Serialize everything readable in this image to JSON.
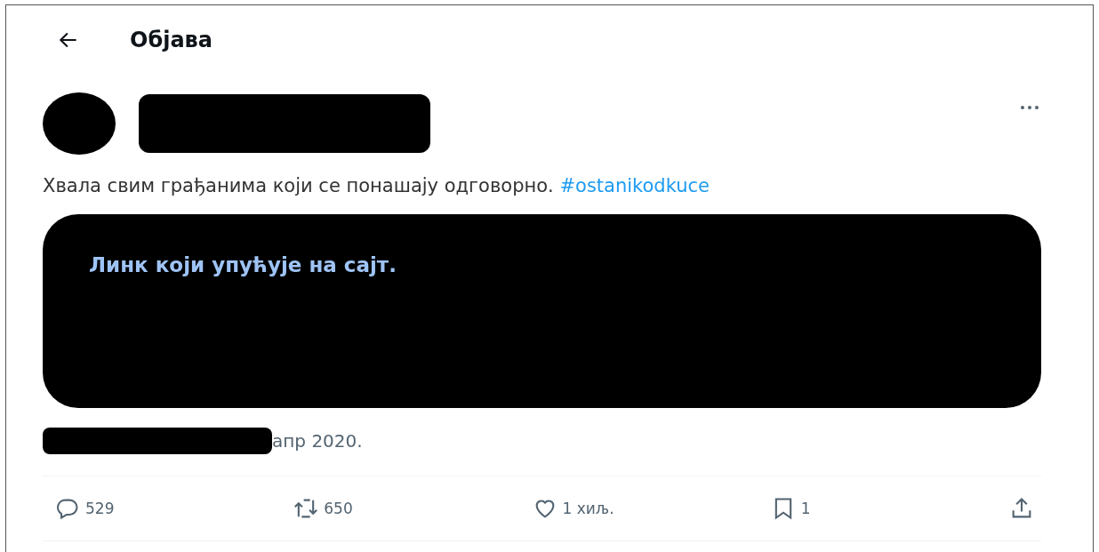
{
  "header": {
    "title": "Објава"
  },
  "post": {
    "text": "Хвала свим грађанима који се понашају одговорно.",
    "hashtag": "#ostanikodkuce",
    "link_card": {
      "text": "Линк који упућује на сајт."
    },
    "date": "апр 2020."
  },
  "actions": [
    {
      "kind": "reply",
      "count": "529"
    },
    {
      "kind": "repost",
      "count": "650"
    },
    {
      "kind": "like",
      "count": "1 хиљ."
    },
    {
      "kind": "bookmark",
      "count": "1"
    },
    {
      "kind": "share"
    }
  ]
}
